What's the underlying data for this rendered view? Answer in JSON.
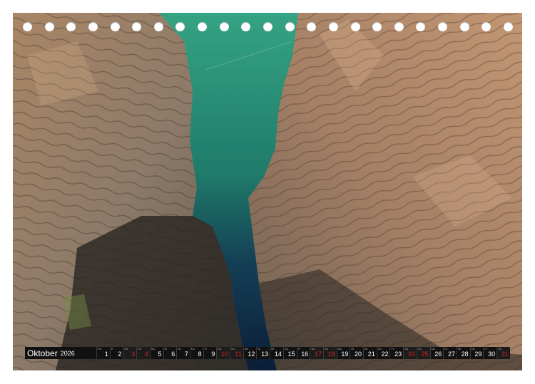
{
  "calendar": {
    "month": "Oktober",
    "year": "2026",
    "days": [
      {
        "dn": "Do",
        "num": "1",
        "weekend": false
      },
      {
        "dn": "Fr",
        "num": "2",
        "weekend": false
      },
      {
        "dn": "Sa",
        "num": "3",
        "weekend": true
      },
      {
        "dn": "So",
        "num": "4",
        "weekend": true
      },
      {
        "dn": "Mo",
        "num": "5",
        "weekend": false
      },
      {
        "dn": "Di",
        "num": "6",
        "weekend": false
      },
      {
        "dn": "Mi",
        "num": "7",
        "weekend": false
      },
      {
        "dn": "Do",
        "num": "8",
        "weekend": false
      },
      {
        "dn": "Fr",
        "num": "9",
        "weekend": false
      },
      {
        "dn": "Sa",
        "num": "10",
        "weekend": true
      },
      {
        "dn": "So",
        "num": "11",
        "weekend": true
      },
      {
        "dn": "Mo",
        "num": "12",
        "weekend": false
      },
      {
        "dn": "Di",
        "num": "13",
        "weekend": false
      },
      {
        "dn": "Mi",
        "num": "14",
        "weekend": false
      },
      {
        "dn": "Do",
        "num": "15",
        "weekend": false
      },
      {
        "dn": "Fr",
        "num": "16",
        "weekend": false
      },
      {
        "dn": "Sa",
        "num": "17",
        "weekend": true
      },
      {
        "dn": "So",
        "num": "18",
        "weekend": true
      },
      {
        "dn": "Mo",
        "num": "19",
        "weekend": false
      },
      {
        "dn": "Di",
        "num": "20",
        "weekend": false
      },
      {
        "dn": "Mi",
        "num": "21",
        "weekend": false
      },
      {
        "dn": "Do",
        "num": "22",
        "weekend": false
      },
      {
        "dn": "Fr",
        "num": "23",
        "weekend": false
      },
      {
        "dn": "Sa",
        "num": "24",
        "weekend": true
      },
      {
        "dn": "So",
        "num": "25",
        "weekend": true
      },
      {
        "dn": "Mo",
        "num": "26",
        "weekend": false
      },
      {
        "dn": "Di",
        "num": "27",
        "weekend": false
      },
      {
        "dn": "Mi",
        "num": "28",
        "weekend": false
      },
      {
        "dn": "Do",
        "num": "29",
        "weekend": false
      },
      {
        "dn": "Fr",
        "num": "30",
        "weekend": false
      },
      {
        "dn": "Sa",
        "num": "31",
        "weekend": true
      }
    ]
  },
  "binding_holes": 23,
  "colors": {
    "water_top": "#2e9a7c",
    "water_deep": "#0f2a4a",
    "rock_light": "#b8916e",
    "rock_shadow": "#3d3832",
    "weekend_red": "#d8222a",
    "bar_bg": "#111111"
  }
}
